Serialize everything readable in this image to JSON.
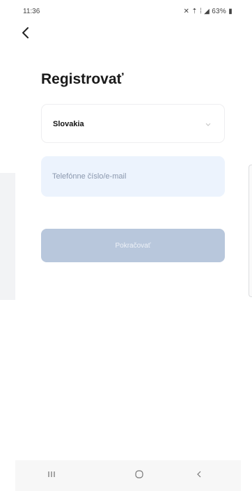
{
  "status_bar": {
    "time": "11:36",
    "battery": "63%"
  },
  "header": {
    "title": "Registrovať"
  },
  "form": {
    "country_value": "Slovakia",
    "phone_placeholder": "Telefónne číslo/e-mail",
    "phone_value": "",
    "continue_label": "Pokračovať"
  },
  "icons": {
    "back": "back-arrow-icon",
    "dropdown": "chevron-down-icon",
    "nav_recents": "recents-icon",
    "nav_home": "home-icon",
    "nav_back": "nav-back-icon"
  },
  "colors": {
    "input_bg": "#ecf3fd",
    "button_disabled": "#b8c7dc"
  }
}
